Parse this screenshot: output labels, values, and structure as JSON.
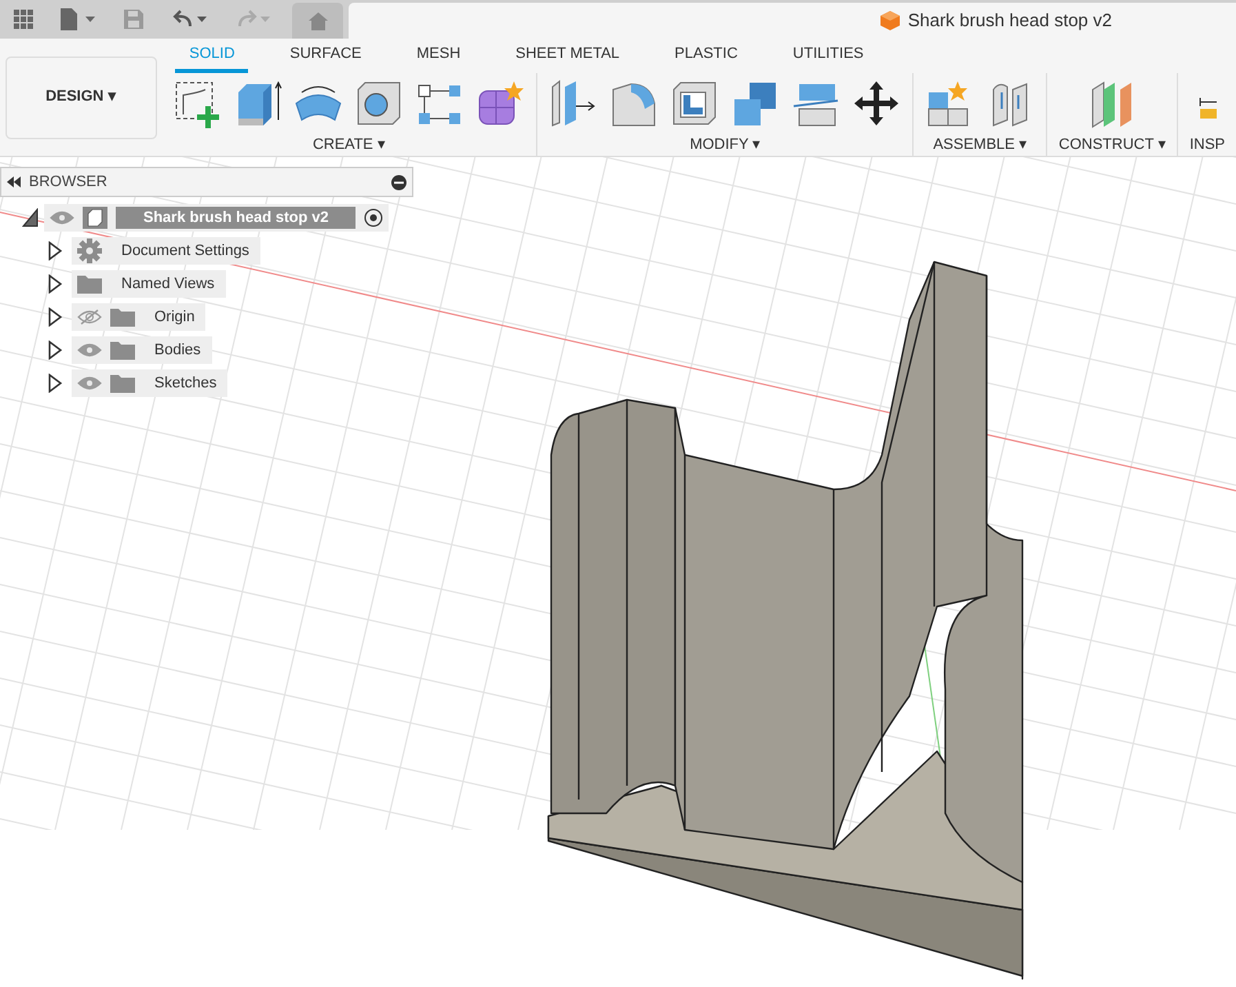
{
  "toolbar_top": {
    "document_tab": "Shark brush head stop v2"
  },
  "workspace": {
    "label": "DESIGN",
    "caret": "▾"
  },
  "tabs": [
    {
      "label": "SOLID",
      "selected": true
    },
    {
      "label": "SURFACE",
      "selected": false
    },
    {
      "label": "MESH",
      "selected": false
    },
    {
      "label": "SHEET METAL",
      "selected": false
    },
    {
      "label": "PLASTIC",
      "selected": false
    },
    {
      "label": "UTILITIES",
      "selected": false
    }
  ],
  "groups": [
    {
      "label": "CREATE",
      "caret": "▾",
      "tools": [
        {
          "kind": "sketch"
        },
        {
          "kind": "extrude"
        },
        {
          "kind": "revolve"
        },
        {
          "kind": "hole"
        },
        {
          "kind": "pattern"
        },
        {
          "kind": "form"
        }
      ]
    },
    {
      "label": "MODIFY",
      "caret": "▾",
      "tools": [
        {
          "kind": "presspull"
        },
        {
          "kind": "fillet"
        },
        {
          "kind": "shell"
        },
        {
          "kind": "combine"
        },
        {
          "kind": "split"
        },
        {
          "kind": "move"
        }
      ]
    },
    {
      "label": "ASSEMBLE",
      "caret": "▾",
      "tools": [
        {
          "kind": "component"
        },
        {
          "kind": "joint"
        }
      ]
    },
    {
      "label": "CONSTRUCT",
      "caret": "▾",
      "tools": [
        {
          "kind": "plane"
        }
      ]
    },
    {
      "label": "INSP",
      "tools": [
        {
          "kind": "measure"
        }
      ]
    }
  ],
  "browser": {
    "title": "BROWSER",
    "root": {
      "label": "Shark brush head stop v2",
      "expanded": true,
      "children": [
        {
          "label": "Document Settings",
          "kind": "settings",
          "expanded": false
        },
        {
          "label": "Named Views",
          "kind": "folder",
          "expanded": false
        },
        {
          "label": "Origin",
          "kind": "folder",
          "visible": false,
          "expanded": false
        },
        {
          "label": "Bodies",
          "kind": "folder",
          "visible": true,
          "expanded": false
        },
        {
          "label": "Sketches",
          "kind": "folder",
          "visible": true,
          "expanded": false
        }
      ]
    }
  }
}
